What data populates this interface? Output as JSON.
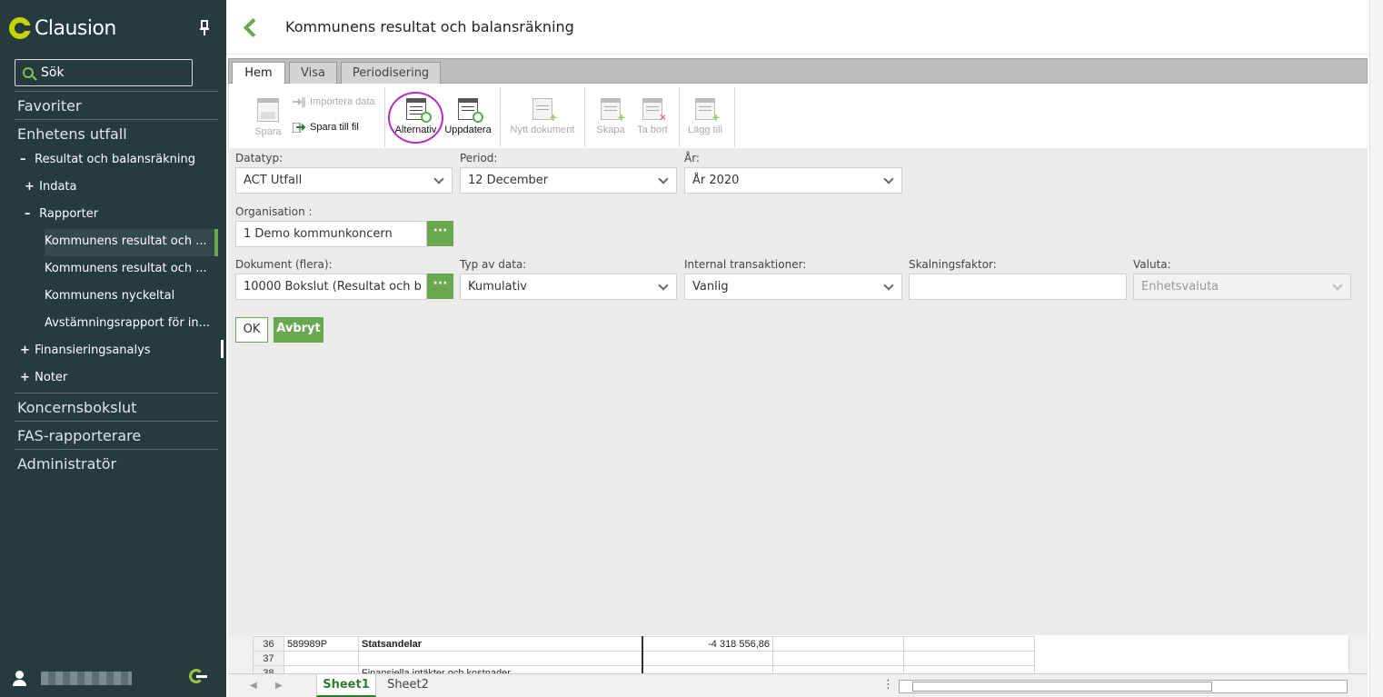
{
  "app": {
    "logo_text": "Clausion",
    "search_label": "Sök"
  },
  "sidebar": {
    "sections": [
      "Favoriter",
      "Enhetens utfall",
      "Koncernsbokslut",
      "FAS-rapporterare",
      "Administratör"
    ],
    "tree": {
      "resultat": "Resultat och balansräkning",
      "indata": "Indata",
      "rapporter": "Rapporter",
      "report1": "Kommunens resultat och ...",
      "report2": "Kommunens resultat och ...",
      "report3": "Kommunens nyckeltal",
      "report4": "Avstämningsrapport för in...",
      "finans": "Finansieringsanalys",
      "noter": "Noter"
    },
    "signs": {
      "minus": "–",
      "plus": "+"
    }
  },
  "header": {
    "title": "Kommunens resultat och balansräkning"
  },
  "ribbon": {
    "tabs": [
      "Hem",
      "Visa",
      "Periodisering"
    ],
    "buttons": {
      "spara": "Spara",
      "importera": "Importera data",
      "spara_fil": "Spara till fil",
      "alternativ": "Alternativ",
      "uppdatera": "Uppdatera",
      "nytt": "Nytt dokument",
      "skapa": "Skapa",
      "ta_bort": "Ta bort",
      "lagg_till": "Lägg till"
    }
  },
  "form": {
    "datatyp": {
      "label": "Datatyp:",
      "value": "ACT Utfall"
    },
    "period": {
      "label": "Period:",
      "value": "12 December"
    },
    "ar": {
      "label": "År:",
      "value": "År 2020"
    },
    "organisation": {
      "label": "Organisation :",
      "value": "1 Demo kommunkoncern"
    },
    "dokument": {
      "label": "Dokument (flera):",
      "value": "10000 Bokslut (Resultat och b"
    },
    "typ": {
      "label": "Typ av data:",
      "value": "Kumulativ"
    },
    "internal": {
      "label": "Internal transaktioner:",
      "value": "Vanlig"
    },
    "skalning": {
      "label": "Skalningsfaktor:",
      "value": ""
    },
    "valuta": {
      "label": "Valuta:",
      "value": "Enhetsvaluta"
    },
    "dots": "···",
    "ok": "OK",
    "cancel": "Avbryt"
  },
  "sheet": {
    "rows": [
      {
        "num": "36",
        "code": "589989P",
        "name": "Statsandelar",
        "value": "-4 318 556,86"
      },
      {
        "num": "37",
        "code": "",
        "name": "",
        "value": ""
      },
      {
        "num": "38",
        "code": "",
        "name": "Finansiella intäkter och kostnader",
        "value": ""
      }
    ],
    "tabs": [
      "Sheet1",
      "Sheet2"
    ],
    "menu_dots": "⋮"
  },
  "colors": {
    "sidebar_bg": "#253b3f",
    "accent_green": "#6aa84f",
    "highlight_ring": "#b32dbf"
  },
  "icons": [
    "search-icon",
    "pin-icon",
    "back-arrow-icon",
    "user-icon",
    "logout-icon",
    "chevron-down-icon",
    "ellipsis-icon"
  ]
}
